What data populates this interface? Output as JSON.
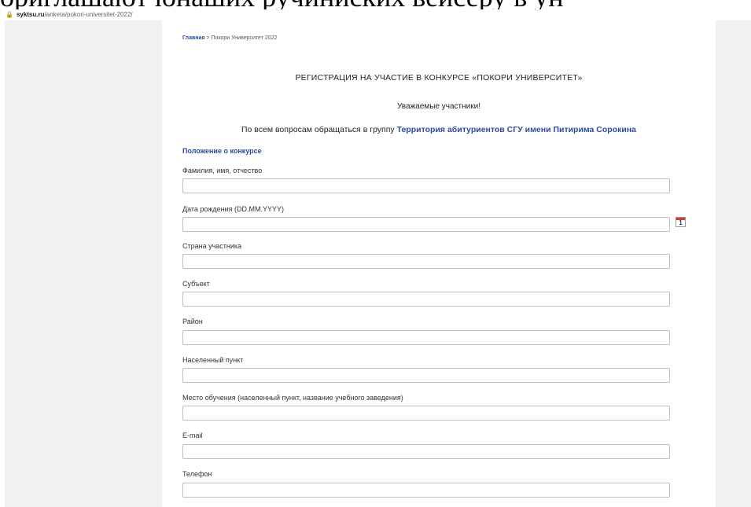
{
  "overlay": {
    "text": "ориглашают юнаших ручиниских вейсеру в ун"
  },
  "browser": {
    "host": "syktsu.ru",
    "path": "/anketa/pokori-universitet-2022/"
  },
  "breadcrumb": {
    "home": "Главная",
    "separator": " > ",
    "current": "Покори Университет 2022"
  },
  "page": {
    "title": "РЕГИСТРАЦИЯ НА УЧАСТИЕ В КОНКУРСЕ «ПОКОРИ УНИВЕРСИТЕТ»",
    "greeting": "Уважаемые участники!",
    "contact_prefix": "По всем вопросам обращаться в группу ",
    "contact_group": "Территория абитуриентов СГУ имени Питирима Сорокина",
    "rules_link": "Положение о конкурсе"
  },
  "form": {
    "fields": [
      {
        "label": "Фамилия, имя, отчество",
        "value": ""
      },
      {
        "label": "Дата рождения (DD.MM.YYYY)",
        "value": ""
      },
      {
        "label": "Страна участника",
        "value": ""
      },
      {
        "label": "Субъект",
        "value": ""
      },
      {
        "label": "Район",
        "value": ""
      },
      {
        "label": "Населенный пункт",
        "value": ""
      },
      {
        "label": "Место обучения (населенный пункт, название учебного заведения)",
        "value": ""
      },
      {
        "label": "E-mail",
        "value": ""
      },
      {
        "label": "Телефон",
        "value": ""
      }
    ],
    "calendar_icon_text": "1"
  },
  "colors": {
    "link": "#2e4a9e",
    "calendar_accent": "#d9382a"
  }
}
